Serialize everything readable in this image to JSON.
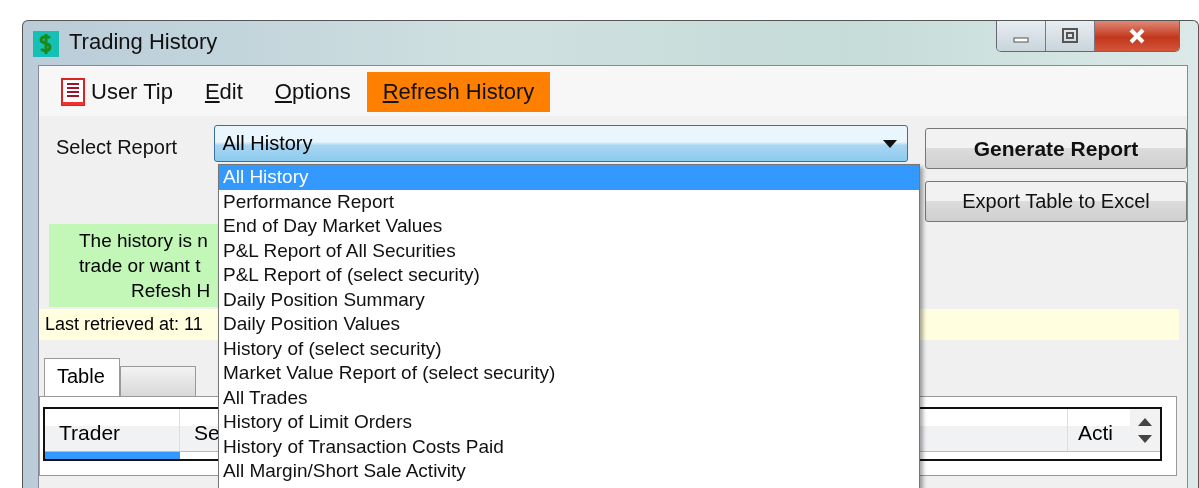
{
  "window": {
    "title": "Trading History",
    "controls": [
      {
        "kind": "minimize"
      },
      {
        "kind": "maximize"
      },
      {
        "kind": "close"
      }
    ]
  },
  "menu": [
    {
      "label": "User Tip",
      "mnemonic": false,
      "selected": false,
      "icon": true
    },
    {
      "label": "Edit",
      "mnemonic": true,
      "selected": false,
      "icon": false
    },
    {
      "label": "Options",
      "mnemonic": true,
      "selected": false,
      "icon": false
    },
    {
      "label": "Refresh History",
      "mnemonic": true,
      "selected": true,
      "icon": false
    }
  ],
  "report_select": {
    "label": "Select Report",
    "value": "All History"
  },
  "buttons": [
    {
      "label": "Generate Report",
      "bold": true
    },
    {
      "label": "Export Table to Excel",
      "bold": false
    }
  ],
  "note": [
    "The history is n",
    "trade or want t",
    "Refesh H"
  ],
  "status": "Last retrieved at: 11",
  "tabs": [
    {
      "label": "Table",
      "selected": true
    },
    {
      "selected": false
    }
  ],
  "table": {
    "columns": [
      "Trader",
      "Se",
      "Acti"
    ]
  },
  "dropdown": [
    {
      "label": "All History",
      "selected": true
    },
    {
      "label": "Performance Report",
      "selected": false
    },
    {
      "label": "End of Day Market Values",
      "selected": false
    },
    {
      "label": "P&L Report of All Securities",
      "selected": false
    },
    {
      "label": "P&L Report of (select security)",
      "selected": false
    },
    {
      "label": "Daily Position Summary",
      "selected": false
    },
    {
      "label": "Daily Position Values",
      "selected": false
    },
    {
      "label": "History of (select security)",
      "selected": false
    },
    {
      "label": "Market Value Report of (select security)",
      "selected": false
    },
    {
      "label": "All Trades",
      "selected": false
    },
    {
      "label": "History of Limit Orders",
      "selected": false
    },
    {
      "label": "History of Transaction Costs Paid",
      "selected": false
    },
    {
      "label": "All Margin/Short Sale Activity",
      "selected": false
    }
  ]
}
